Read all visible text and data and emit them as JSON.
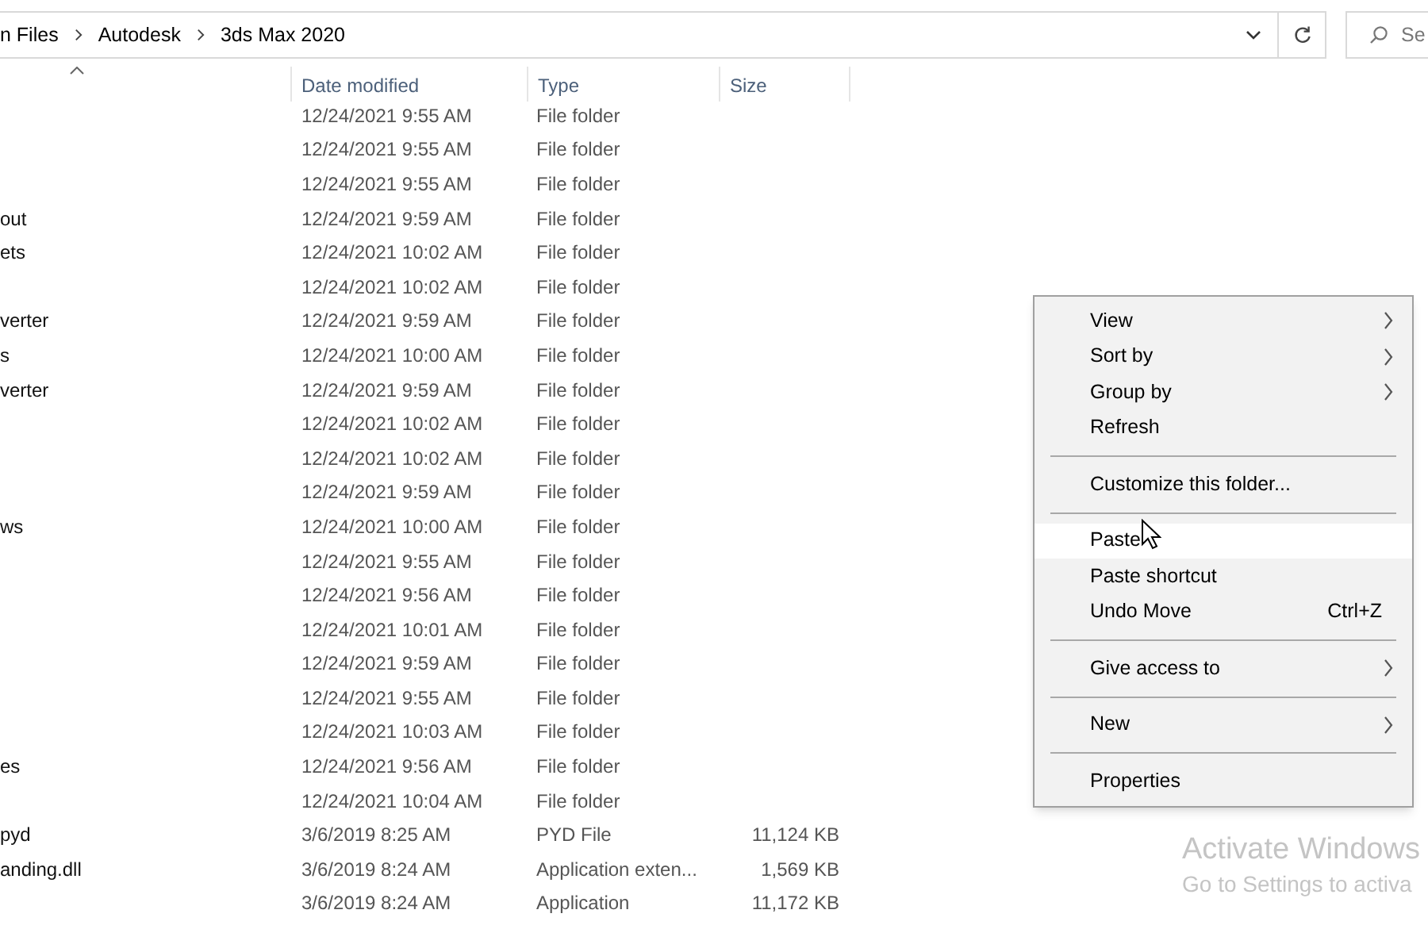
{
  "address_bar": {
    "crumbs": [
      "n Files",
      "Autodesk",
      "3ds Max 2020"
    ]
  },
  "search": {
    "placeholder": "Se"
  },
  "table": {
    "columns": [
      {
        "label": "Date modified"
      },
      {
        "label": "Type"
      },
      {
        "label": "Size"
      }
    ],
    "rows": [
      {
        "name": "",
        "date": "12/24/2021 9:55 AM",
        "type": "File folder",
        "size": ""
      },
      {
        "name": "",
        "date": "12/24/2021 9:55 AM",
        "type": "File folder",
        "size": ""
      },
      {
        "name": "",
        "date": "12/24/2021 9:55 AM",
        "type": "File folder",
        "size": ""
      },
      {
        "name": "out",
        "date": "12/24/2021 9:59 AM",
        "type": "File folder",
        "size": ""
      },
      {
        "name": "ets",
        "date": "12/24/2021 10:02 AM",
        "type": "File folder",
        "size": ""
      },
      {
        "name": "",
        "date": "12/24/2021 10:02 AM",
        "type": "File folder",
        "size": ""
      },
      {
        "name": "verter",
        "date": "12/24/2021 9:59 AM",
        "type": "File folder",
        "size": ""
      },
      {
        "name": "s",
        "date": "12/24/2021 10:00 AM",
        "type": "File folder",
        "size": ""
      },
      {
        "name": "verter",
        "date": "12/24/2021 9:59 AM",
        "type": "File folder",
        "size": ""
      },
      {
        "name": "",
        "date": "12/24/2021 10:02 AM",
        "type": "File folder",
        "size": ""
      },
      {
        "name": "",
        "date": "12/24/2021 10:02 AM",
        "type": "File folder",
        "size": ""
      },
      {
        "name": "",
        "date": "12/24/2021 9:59 AM",
        "type": "File folder",
        "size": ""
      },
      {
        "name": "ws",
        "date": "12/24/2021 10:00 AM",
        "type": "File folder",
        "size": ""
      },
      {
        "name": "",
        "date": "12/24/2021 9:55 AM",
        "type": "File folder",
        "size": ""
      },
      {
        "name": "",
        "date": "12/24/2021 9:56 AM",
        "type": "File folder",
        "size": ""
      },
      {
        "name": "",
        "date": "12/24/2021 10:01 AM",
        "type": "File folder",
        "size": ""
      },
      {
        "name": "",
        "date": "12/24/2021 9:59 AM",
        "type": "File folder",
        "size": ""
      },
      {
        "name": "",
        "date": "12/24/2021 9:55 AM",
        "type": "File folder",
        "size": ""
      },
      {
        "name": "",
        "date": "12/24/2021 10:03 AM",
        "type": "File folder",
        "size": ""
      },
      {
        "name": "es",
        "date": "12/24/2021 9:56 AM",
        "type": "File folder",
        "size": ""
      },
      {
        "name": "",
        "date": "12/24/2021 10:04 AM",
        "type": "File folder",
        "size": ""
      },
      {
        "name": "pyd",
        "date": "3/6/2019 8:25 AM",
        "type": "PYD File",
        "size": "11,124 KB"
      },
      {
        "name": "anding.dll",
        "date": "3/6/2019 8:24 AM",
        "type": "Application exten...",
        "size": "1,569 KB"
      },
      {
        "name": "",
        "date": "3/6/2019 8:24 AM",
        "type": "Application",
        "size": "11,172 KB"
      }
    ]
  },
  "context_menu": {
    "items": [
      {
        "kind": "item",
        "label": "View",
        "submenu": true,
        "selected": false
      },
      {
        "kind": "item",
        "label": "Sort by",
        "submenu": true,
        "selected": false
      },
      {
        "kind": "item",
        "label": "Group by",
        "submenu": true,
        "selected": false
      },
      {
        "kind": "item",
        "label": "Refresh",
        "submenu": false,
        "selected": false
      },
      {
        "kind": "separator"
      },
      {
        "kind": "item",
        "label": "Customize this folder...",
        "submenu": false,
        "selected": false
      },
      {
        "kind": "separator"
      },
      {
        "kind": "item",
        "label": "Paste",
        "submenu": false,
        "selected": true
      },
      {
        "kind": "item",
        "label": "Paste shortcut",
        "submenu": false,
        "selected": false
      },
      {
        "kind": "item",
        "label": "Undo Move",
        "shortcut": "Ctrl+Z",
        "submenu": false,
        "selected": false
      },
      {
        "kind": "separator"
      },
      {
        "kind": "item",
        "label": "Give access to",
        "submenu": true,
        "selected": false
      },
      {
        "kind": "separator"
      },
      {
        "kind": "item",
        "label": "New",
        "submenu": true,
        "selected": false
      },
      {
        "kind": "separator"
      },
      {
        "kind": "item",
        "label": "Properties",
        "submenu": false,
        "selected": false
      }
    ]
  },
  "activation_notice": {
    "title": "Activate Windows",
    "subtitle": "Go to Settings to activa"
  }
}
